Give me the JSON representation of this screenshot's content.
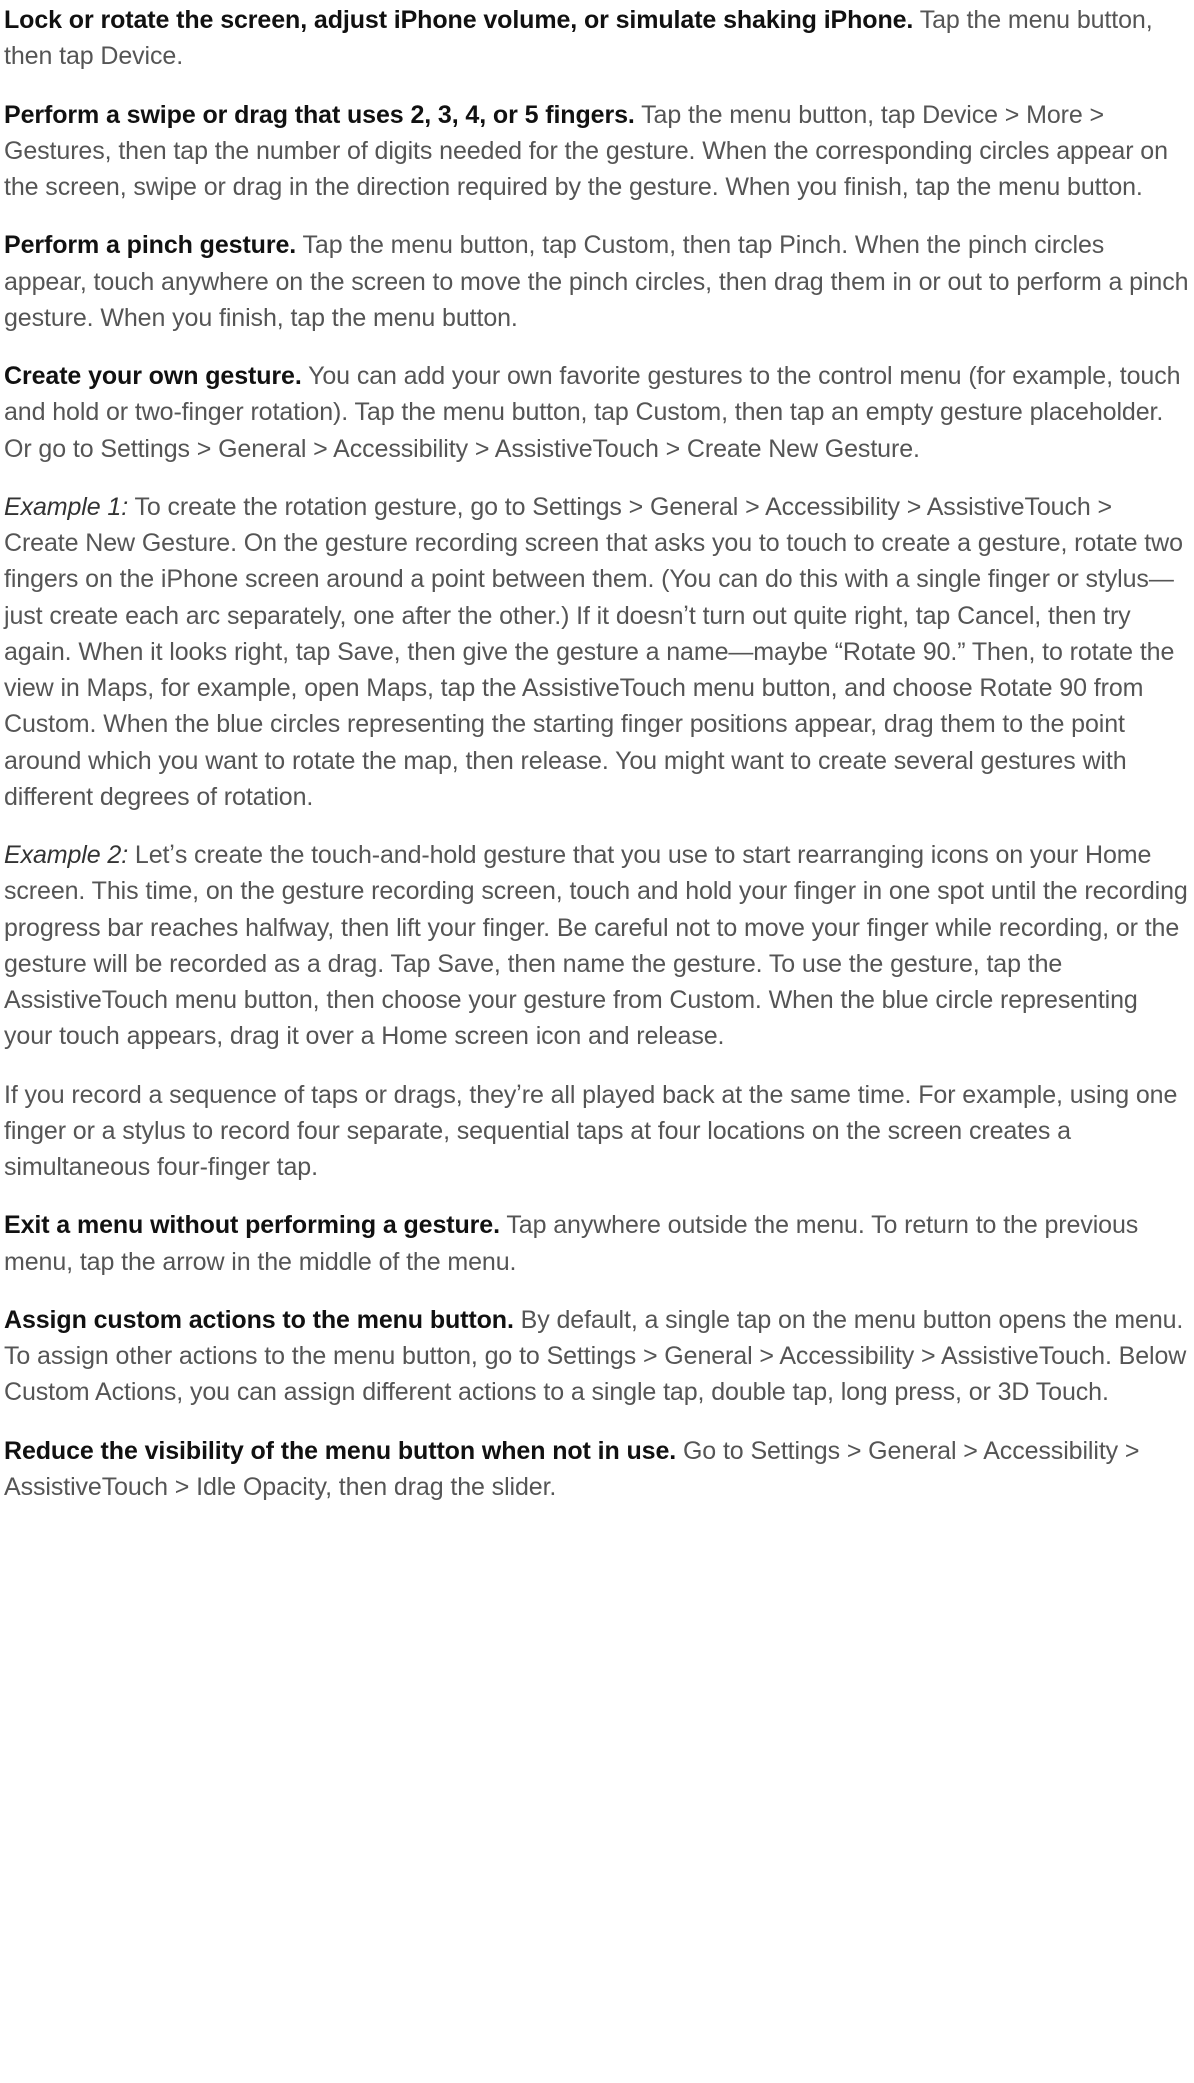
{
  "paragraphs": {
    "p1_bold": "Lock or rotate the screen, adjust iPhone volume, or simulate shaking iPhone.",
    "p1_text": " Tap the menu button, then tap Device.",
    "p2_bold": "Perform a swipe or drag that uses 2, 3, 4, or 5 fingers.",
    "p2_text": " Tap the menu button, tap Device > More > Gestures, then tap the number of digits needed for the gesture. When the corresponding circles appear on the screen, swipe or drag in the direction required by the gesture. When you finish, tap the menu button.",
    "p3_bold": "Perform a pinch gesture.",
    "p3_text": " Tap the menu button, tap Custom, then tap Pinch. When the pinch circles appear, touch anywhere on the screen to move the pinch circles, then drag them in or out to perform a pinch gesture. When you finish, tap the menu button.",
    "p4_bold": "Create your own gesture.",
    "p4_text": " You can add your own favorite gestures to the control menu (for example, touch and hold or two-finger rotation). Tap the menu button, tap Custom, then tap an empty gesture placeholder. Or go to Settings > General > Accessibility > AssistiveTouch > Create New Gesture.",
    "p5_italic": "Example 1:",
    "p5_text": " To create the rotation gesture, go to Settings > General > Accessibility > AssistiveTouch > Create New Gesture. On the gesture recording screen that asks you to touch to create a gesture, rotate two fingers on the iPhone screen around a point between them. (You can do this with a single finger or stylus—just create each arc separately, one after the other.) If it doesnʼt turn out quite right, tap Cancel, then try again. When it looks right, tap Save, then give the gesture a name—maybe “Rotate 90.” Then, to rotate the view in Maps, for example, open Maps, tap the AssistiveTouch menu button, and choose Rotate 90 from Custom. When the blue circles representing the starting finger positions appear, drag them to the point around which you want to rotate the map, then release. You might want to create several gestures with different degrees of rotation.",
    "p6_italic": "Example 2:",
    "p6_text": " Letʼs create the touch-and-hold gesture that you use to start rearranging icons on your Home screen. This time, on the gesture recording screen, touch and hold your finger in one spot until the recording progress bar reaches halfway, then lift your finger. Be careful not to move your finger while recording, or the gesture will be recorded as a drag. Tap Save, then name the gesture. To use the gesture, tap the AssistiveTouch menu button, then choose your gesture from Custom. When the blue circle representing your touch appears, drag it over a Home screen icon and release.",
    "p7_text": "If you record a sequence of taps or drags, theyʼre all played back at the same time. For example, using one finger or a stylus to record four separate, sequential taps at four locations on the screen creates a simultaneous four-finger tap.",
    "p8_bold": "Exit a menu without performing a gesture.",
    "p8_text": " Tap anywhere outside the menu. To return to the previous menu, tap the arrow in the middle of the menu.",
    "p9_bold": "Assign custom actions to the menu button.",
    "p9_text": " By default, a single tap on the menu button opens the menu. To assign other actions to the menu button, go to Settings > General > Accessibility > AssistiveTouch. Below Custom Actions, you can assign different actions to a single tap, double tap, long press, or 3D Touch.",
    "p10_bold": "Reduce the visibility of the menu button when not in use.",
    "p10_text": " Go to Settings > General > Accessibility > AssistiveTouch > Idle Opacity, then drag the slider."
  }
}
